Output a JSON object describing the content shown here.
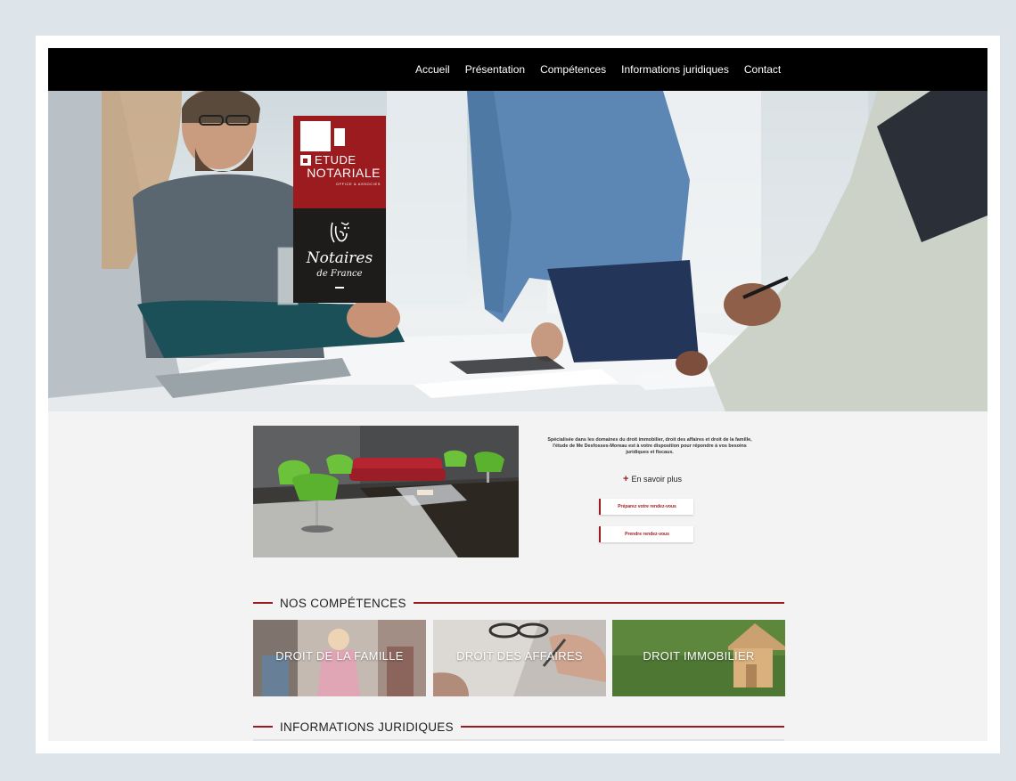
{
  "nav": {
    "items": [
      {
        "label": "Accueil"
      },
      {
        "label": "Présentation"
      },
      {
        "label": "Compétences"
      },
      {
        "label": "Informations juridiques"
      },
      {
        "label": "Contact"
      }
    ]
  },
  "logo": {
    "etude": "ETUDE",
    "notariale": "NOTARIALE",
    "office": "OFFICE & ASSOCIES",
    "notaires": "Notaires",
    "de_france": "de France",
    "brand_red": "#9b1b1f"
  },
  "intro": {
    "text": "Spécialisée dans les domaines du droit immobilier, droit des affaires et droit de la famille, l'étude de Me Desfosses-Moreau est à votre disposition pour répondre à vos besoins juridiques et fiscaux.",
    "more_label": "En savoir plus",
    "cta_prepare": "Préparez votre rendez-vous",
    "cta_book": "Prendre rendez-vous"
  },
  "sections": {
    "competences": "NOS COMPÉTENCES",
    "juridiques": "INFORMATIONS JURIDIQUES"
  },
  "tiles": [
    {
      "label": "DROIT DE LA FAMILLE"
    },
    {
      "label": "DROIT DES AFFAIRES"
    },
    {
      "label": "DROIT IMMOBILIER"
    }
  ]
}
